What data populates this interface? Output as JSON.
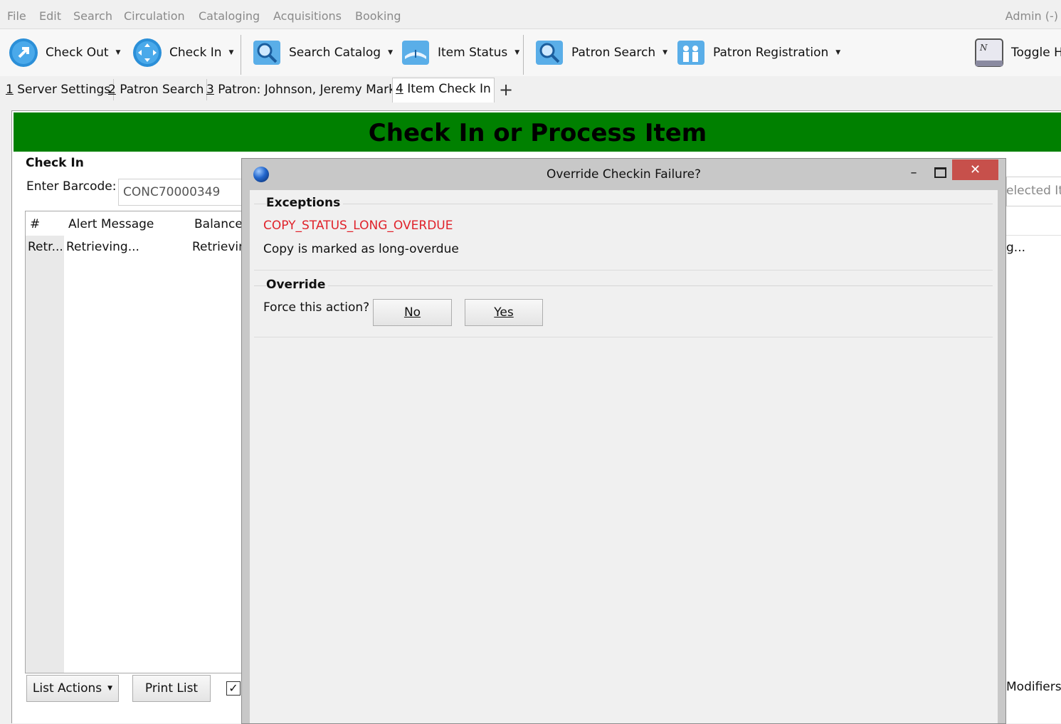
{
  "menu": {
    "items": [
      "File",
      "Edit",
      "Search",
      "Circulation",
      "Cataloging",
      "Acquisitions",
      "Booking"
    ],
    "admin": "Admin (-)"
  },
  "toolbar": {
    "check_out": "Check Out",
    "check_in": "Check In",
    "search_catalog": "Search Catalog",
    "item_status": "Item Status",
    "patron_search": "Patron Search",
    "patron_registration": "Patron Registration",
    "toggle": "Toggle H"
  },
  "tabs": [
    {
      "num": "1",
      "label": " Server Settings"
    },
    {
      "num": "2",
      "label": " Patron Search"
    },
    {
      "num": "3",
      "label": " Patron: Johnson, Jeremy Mark"
    },
    {
      "num": "4",
      "label": " Item Check In"
    }
  ],
  "banner": {
    "title": "Check In or Process Item"
  },
  "checkin": {
    "heading": "Check In",
    "barcode_label": "Enter Barcode:",
    "barcode_value": "CONC70000349"
  },
  "list": {
    "headers": {
      "num": "#",
      "alert": "Alert Message",
      "balance": "Balance"
    },
    "row": {
      "num": "Retr...",
      "alert": "Retrieving...",
      "balance": "Retrievin"
    }
  },
  "right_panel": {
    "selected": "elected Ite",
    "retrieving": "g...",
    "modifiers": "Modifiers"
  },
  "bottom": {
    "list_actions": "List Actions",
    "print_list": "Print List",
    "checkbox_mark": "✓"
  },
  "dialog": {
    "title": "Override Checkin Failure?",
    "close": "✕",
    "minimize": "–",
    "exceptions_title": "Exceptions",
    "exception_code": "COPY_STATUS_LONG_OVERDUE",
    "exception_desc": "Copy is marked as long-overdue",
    "override_title": "Override",
    "force_label": "Force this action?",
    "no": "No",
    "yes": "Yes"
  },
  "colors": {
    "banner": "#008000",
    "exception_code": "#e0222a",
    "close_button": "#c7504b"
  }
}
